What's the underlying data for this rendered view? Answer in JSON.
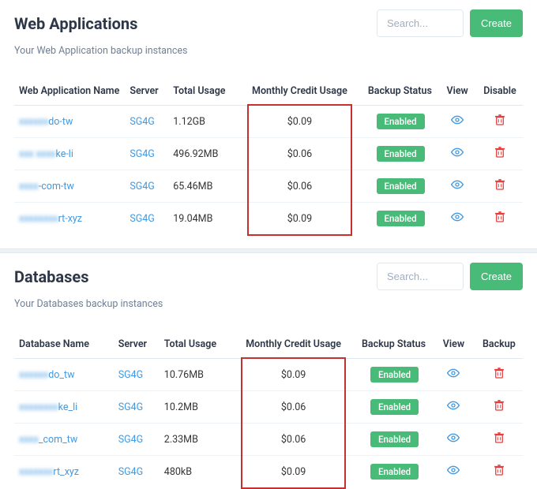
{
  "web_apps": {
    "title": "Web Applications",
    "subtitle": "Your Web Application backup instances",
    "search_placeholder": "Search...",
    "create_label": "Create",
    "columns": {
      "name": "Web Application Name",
      "server": "Server",
      "usage": "Total Usage",
      "mcu": "Monthly Credit Usage",
      "status": "Backup Status",
      "view": "View",
      "action": "Disable"
    },
    "rows": [
      {
        "name_blur": "xxxxxx",
        "name_clear": "do-tw",
        "server": "SG4G",
        "usage": "1.12GB",
        "mcu": "$0.09",
        "status": "Enabled"
      },
      {
        "name_blur": "xxx xxxx",
        "name_clear": "ke-li",
        "server": "SG4G",
        "usage": "496.92MB",
        "mcu": "$0.06",
        "status": "Enabled"
      },
      {
        "name_blur": "xxxx",
        "name_clear": "-com-tw",
        "server": "SG4G",
        "usage": "65.46MB",
        "mcu": "$0.06",
        "status": "Enabled"
      },
      {
        "name_blur": "xxxxxxxx",
        "name_clear": "rt-xyz",
        "server": "SG4G",
        "usage": "19.04MB",
        "mcu": "$0.09",
        "status": "Enabled"
      }
    ]
  },
  "databases": {
    "title": "Databases",
    "subtitle": "Your Databases backup instances",
    "search_placeholder": "Search...",
    "create_label": "Create",
    "columns": {
      "name": "Database Name",
      "server": "Server",
      "usage": "Total Usage",
      "mcu": "Monthly Credit Usage",
      "status": "Backup Status",
      "view": "View",
      "action": "Backup"
    },
    "rows": [
      {
        "name_blur": "xxxxxx",
        "name_clear": "do_tw",
        "server": "SG4G",
        "usage": "10.76MB",
        "mcu": "$0.09",
        "status": "Enabled"
      },
      {
        "name_blur": "xxxxxxxx",
        "name_clear": "ke_li",
        "server": "SG4G",
        "usage": "10.2MB",
        "mcu": "$0.06",
        "status": "Enabled"
      },
      {
        "name_blur": "xxxx",
        "name_clear": "_com_tw",
        "server": "SG4G",
        "usage": "2.33MB",
        "mcu": "$0.06",
        "status": "Enabled"
      },
      {
        "name_blur": "xxxxxxx",
        "name_clear": "rt_xyz",
        "server": "SG4G",
        "usage": "480kB",
        "mcu": "$0.09",
        "status": "Enabled"
      }
    ]
  }
}
